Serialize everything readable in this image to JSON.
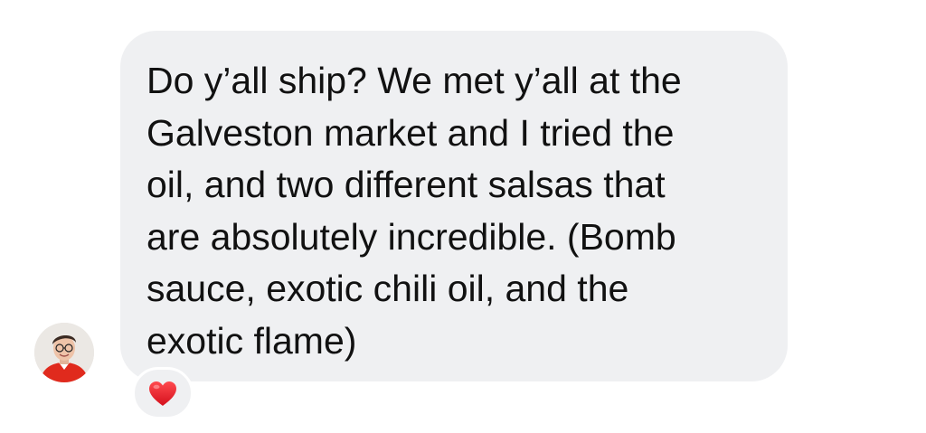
{
  "message": {
    "lines": [
      "Do y’all ship? We met y’all at the",
      "Galveston market and I tried the",
      "oil, and two different salsas that",
      "are absolutely incredible. (Bomb",
      "sauce, exotic chili oil, and the",
      "exotic flame)"
    ]
  },
  "sender": {
    "avatar_icon": "user-avatar",
    "shirt_color": "#e02a1d"
  },
  "reaction": {
    "icon": "red-heart-icon",
    "color": "#e0202a"
  },
  "bubble": {
    "background": "#eff0f2"
  }
}
